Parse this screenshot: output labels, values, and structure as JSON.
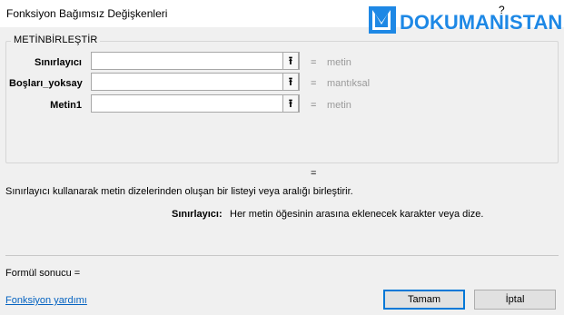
{
  "window": {
    "title": "Fonksiyon Bağımsız Değişkenleri",
    "help": "?"
  },
  "watermark": {
    "text": "DOKUMANISTAN"
  },
  "function": {
    "name": "METİNBİRLEŞTİR",
    "args": [
      {
        "label": "Sınırlayıcı",
        "value": "",
        "eq": "=",
        "hint": "metin"
      },
      {
        "label": "Boşları_yoksay",
        "value": "",
        "eq": "=",
        "hint": "mantıksal"
      },
      {
        "label": "Metin1",
        "value": "",
        "eq": "=",
        "hint": "metin"
      }
    ],
    "ref_glyph": "⭱",
    "result_eq": "="
  },
  "description": "Sınırlayıcı kullanarak metin dizelerinden oluşan bir listeyi veya aralığı birleştirir.",
  "arg_help": {
    "label": "Sınırlayıcı:",
    "text": "Her metin öğesinin arasına eklenecek karakter veya dize."
  },
  "formula_result": "Formül sonucu =",
  "help_link": "Fonksiyon yardımı",
  "buttons": {
    "ok": "Tamam",
    "cancel": "İptal"
  },
  "colors": {
    "link": "#0563c1",
    "primary_border": "#0078d7",
    "logo_blue": "#1e88e5"
  }
}
